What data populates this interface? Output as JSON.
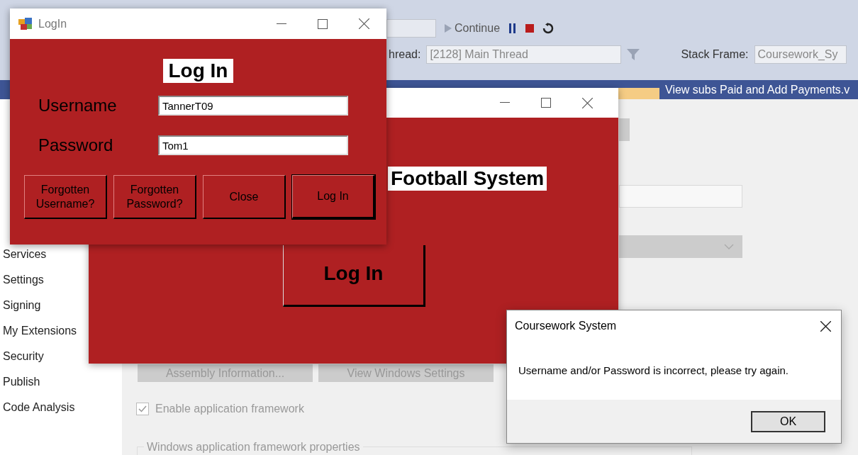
{
  "ide": {
    "toolbar": {
      "continue_label": "Continue",
      "thread_label": "hread:",
      "thread_value": "[2128] Main Thread",
      "stack_frame_label": "Stack Frame:",
      "stack_frame_value": "Coursework_Sy"
    },
    "tabs": [
      {
        "label": "View subs Paid and Add Payments.v",
        "selected": false
      }
    ],
    "sidebar": {
      "items": [
        "Services",
        "Settings",
        "Signing",
        "My Extensions",
        "Security",
        "Publish",
        "Code Analysis"
      ]
    },
    "buttons": [
      "Assembly Information...",
      "View Windows Settings"
    ],
    "checkbox": {
      "label": "Enable application framework",
      "checked": true
    },
    "group_title": "Windows application framework properties"
  },
  "football_window": {
    "heading": "Football System",
    "button": "Log In"
  },
  "login_window": {
    "title": "LogIn",
    "heading": "Log In",
    "fields": [
      {
        "label": "Username",
        "value": "TannerT09"
      },
      {
        "label": "Password",
        "value": "Tom1"
      }
    ],
    "buttons": [
      {
        "label": "Forgotten Username?",
        "default": false
      },
      {
        "label": "Forgotten Password?",
        "default": false
      },
      {
        "label": "Close",
        "default": false
      },
      {
        "label": "Log In",
        "default": true
      }
    ]
  },
  "message_box": {
    "title": "Coursework System",
    "message": "Username and/or Password is incorrect, please try again.",
    "button": "OK"
  }
}
